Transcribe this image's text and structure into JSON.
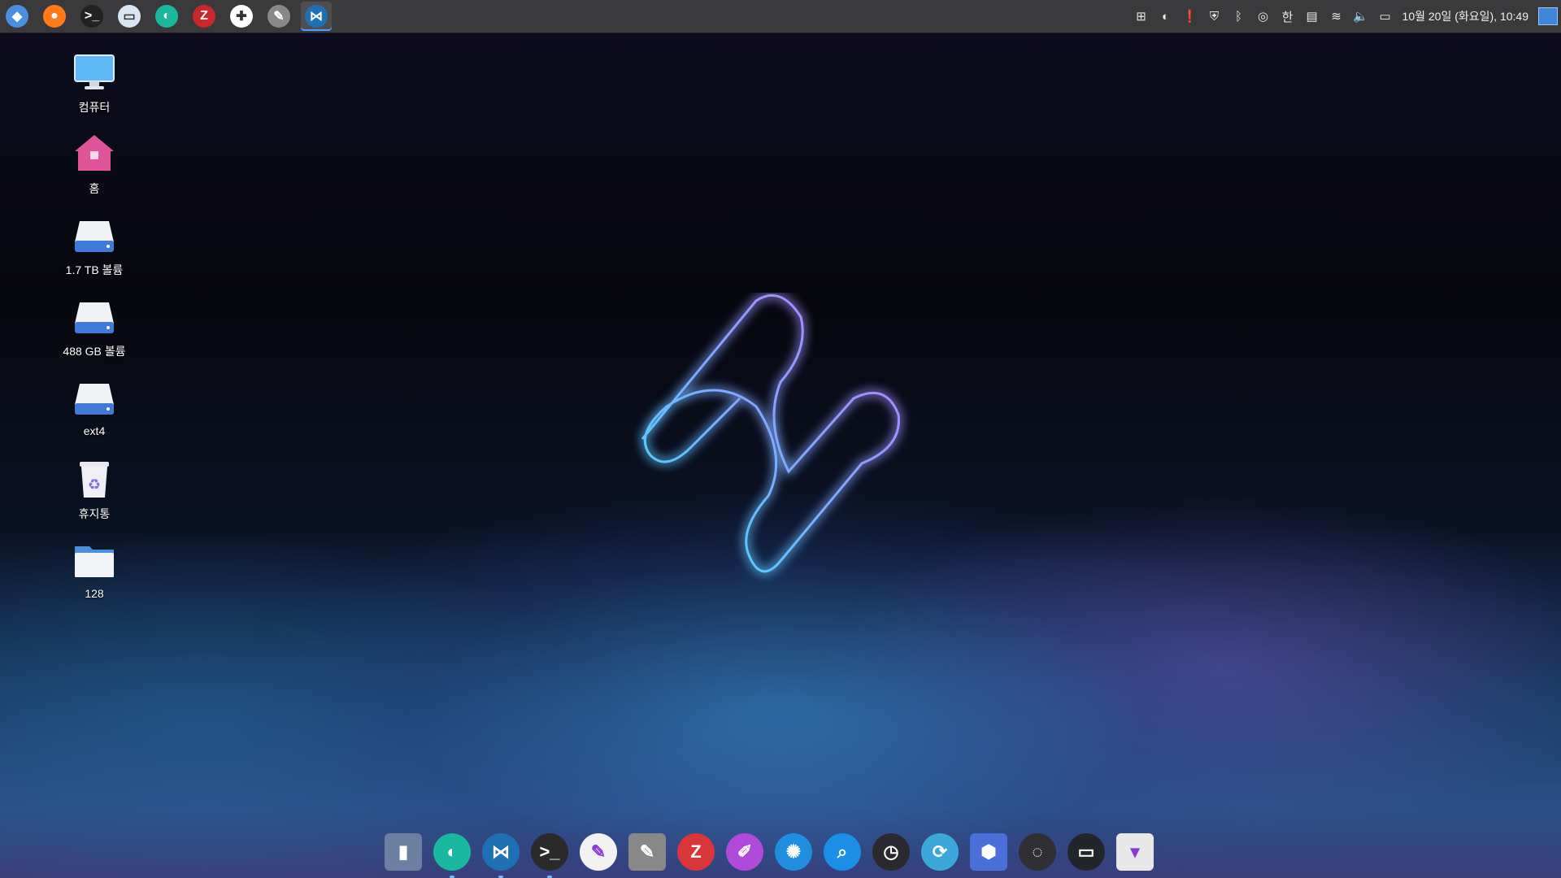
{
  "topbar": {
    "launchers": [
      {
        "name": "menu",
        "glyph": "◆",
        "color": "#4a8fe0"
      },
      {
        "name": "firefox",
        "glyph": "●",
        "color": "#ff7b1a"
      },
      {
        "name": "terminal",
        "glyph": ">_",
        "color": "#222222"
      },
      {
        "name": "files",
        "glyph": "▭",
        "color": "#d9e6f2"
      },
      {
        "name": "naver-whale",
        "glyph": "◐",
        "color": "#1bb8a0"
      },
      {
        "name": "filezilla",
        "glyph": "Z",
        "color": "#c8282c"
      },
      {
        "name": "slack",
        "glyph": "✚",
        "color": "#ffffff"
      },
      {
        "name": "rainbow-tool",
        "glyph": "✎",
        "color": "#888888"
      },
      {
        "name": "vscode",
        "glyph": "⋈",
        "color": "#1f6fb5"
      }
    ],
    "tray": [
      "⊞",
      "◐",
      "❗",
      "⛨",
      "ᛒ",
      "◎",
      "한",
      "▤",
      "≋",
      "🔈",
      "▭"
    ],
    "clock": "10월 20일 (화요일), 10:49"
  },
  "desktop": {
    "icons": [
      {
        "label": "컴퓨터",
        "type": "computer"
      },
      {
        "label": "홈",
        "type": "home"
      },
      {
        "label": "1.7 TB 볼륨",
        "type": "drive"
      },
      {
        "label": "488 GB 볼륨",
        "type": "drive"
      },
      {
        "label": "ext4",
        "type": "drive"
      },
      {
        "label": "휴지통",
        "type": "trash"
      },
      {
        "label": "128",
        "type": "folder"
      }
    ]
  },
  "dock": {
    "items": [
      {
        "name": "system-monitor",
        "glyph": "▮",
        "color": "#6b7fa0",
        "running": false
      },
      {
        "name": "naver-whale",
        "glyph": "◐",
        "color": "#1bb8a0",
        "running": true
      },
      {
        "name": "vscode",
        "glyph": "⋈",
        "color": "#1f6fb5",
        "running": true
      },
      {
        "name": "terminal",
        "glyph": ">_",
        "color": "#2a2a2a",
        "running": true
      },
      {
        "name": "text-editor",
        "glyph": "✎",
        "color": "#f2f2f2",
        "running": false
      },
      {
        "name": "rainbow-tool",
        "glyph": "✎",
        "color": "#888888",
        "running": false
      },
      {
        "name": "filezilla",
        "glyph": "Z",
        "color": "#d9363a",
        "running": false
      },
      {
        "name": "paint",
        "glyph": "✐",
        "color": "#b04ad8",
        "running": false
      },
      {
        "name": "camera-shutter",
        "glyph": "✺",
        "color": "#1f8ee0",
        "running": false
      },
      {
        "name": "search",
        "glyph": "⌕",
        "color": "#1b8ee6",
        "running": false
      },
      {
        "name": "dashboard",
        "glyph": "◷",
        "color": "#2a2a2e",
        "running": false
      },
      {
        "name": "timeshift",
        "glyph": "⟳",
        "color": "#3aa8d8",
        "running": false
      },
      {
        "name": "cubes",
        "glyph": "⬢",
        "color": "#4a6fd8",
        "running": false
      },
      {
        "name": "spinner",
        "glyph": "◌",
        "color": "#303034",
        "running": false
      },
      {
        "name": "window-app",
        "glyph": "▭",
        "color": "#22252c",
        "running": false
      },
      {
        "name": "tuxedo",
        "glyph": "▾",
        "color": "#e8e8e8",
        "running": false
      }
    ]
  }
}
